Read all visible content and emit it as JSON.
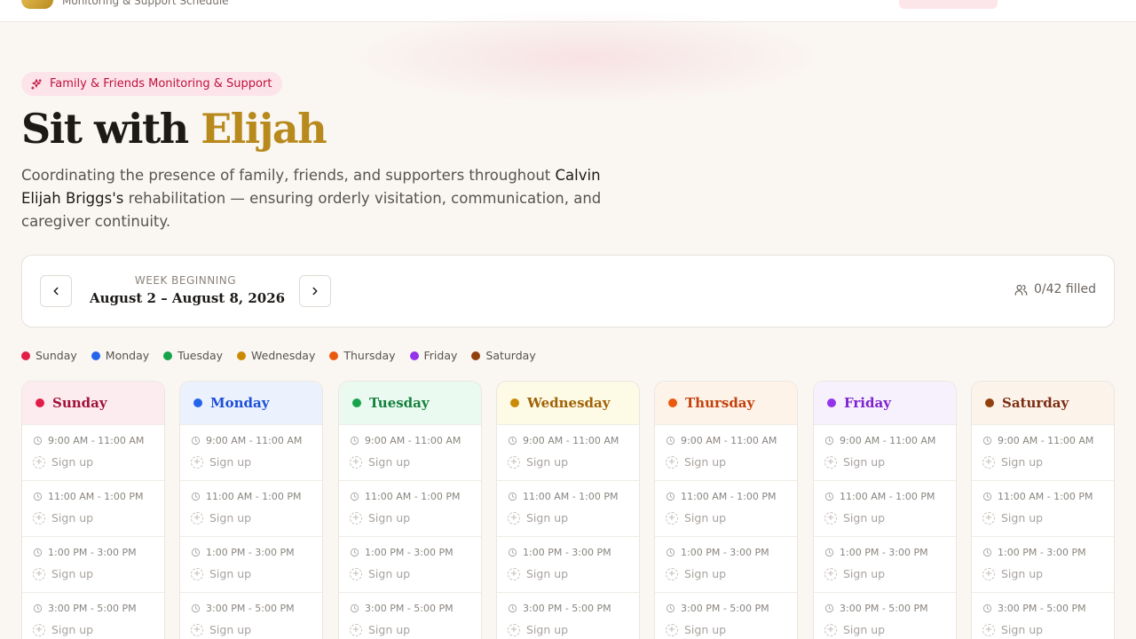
{
  "header": {
    "subtitle": "Monitoring & Support Schedule"
  },
  "hero": {
    "badge": "Family & Friends Monitoring & Support",
    "title_prefix": "Sit with ",
    "title_accent": "Elijah",
    "desc_before": "Coordinating the presence of family, friends, and supporters throughout ",
    "desc_highlight": "Calvin Elijah Briggs's",
    "desc_after": " rehabilitation — ensuring orderly visitation, communication, and caregiver continuity."
  },
  "week": {
    "label": "WEEK BEGINNING",
    "range": "August 2 – August 8, 2026",
    "filled": "0/42 filled"
  },
  "colors": {
    "accent": "#b8891c",
    "badge_bg": "#fde4ea",
    "badge_text": "#be123c"
  },
  "days": [
    {
      "name": "Sunday",
      "color": "#e11d48",
      "text": "#9f1239",
      "bg": "#fdecef"
    },
    {
      "name": "Monday",
      "color": "#2563eb",
      "text": "#1d4ed8",
      "bg": "#ebf2fd"
    },
    {
      "name": "Tuesday",
      "color": "#16a34a",
      "text": "#15803d",
      "bg": "#eafaf0"
    },
    {
      "name": "Wednesday",
      "color": "#ca8a04",
      "text": "#a16207",
      "bg": "#fdfae6"
    },
    {
      "name": "Thursday",
      "color": "#ea580c",
      "text": "#c2410c",
      "bg": "#fef3e9"
    },
    {
      "name": "Friday",
      "color": "#9333ea",
      "text": "#7e22ce",
      "bg": "#f7f1fd"
    },
    {
      "name": "Saturday",
      "color": "#92400e",
      "text": "#7c2d12",
      "bg": "#fcf3ea"
    }
  ],
  "slots": [
    {
      "time": "9:00 AM - 11:00 AM",
      "action": "Sign up"
    },
    {
      "time": "11:00 AM - 1:00 PM",
      "action": "Sign up"
    },
    {
      "time": "1:00 PM - 3:00 PM",
      "action": "Sign up"
    },
    {
      "time": "3:00 PM - 5:00 PM",
      "action": "Sign up"
    }
  ]
}
